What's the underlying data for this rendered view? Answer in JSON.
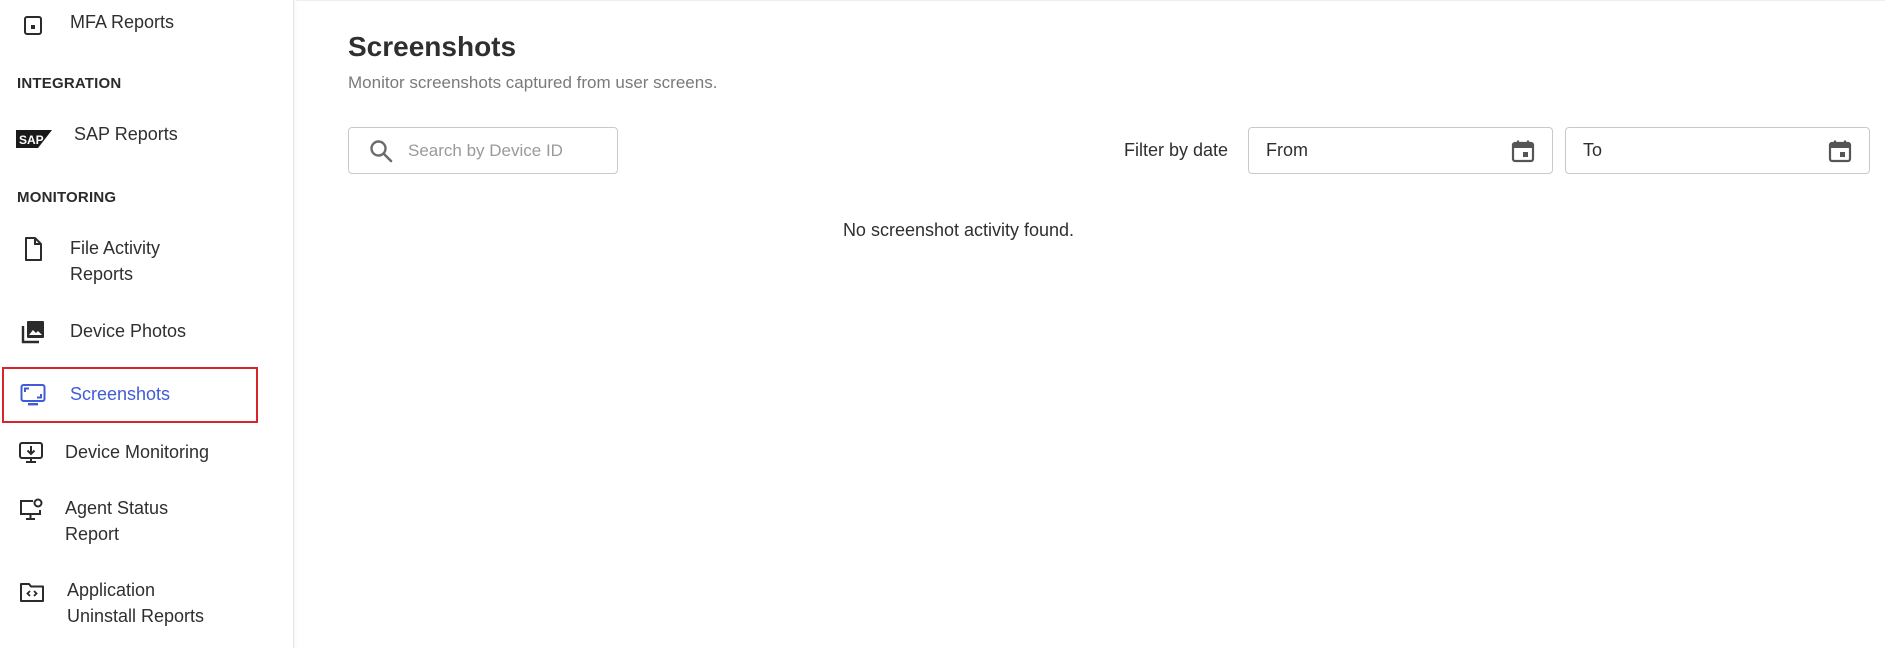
{
  "sidebar": {
    "partial_item": {
      "label": "MFA Reports",
      "icon": "calendar-dot-icon"
    },
    "sections": [
      {
        "title": "INTEGRATION"
      },
      {
        "title": "MONITORING"
      }
    ],
    "sap": {
      "logo_text": "SAP",
      "label": "SAP Reports"
    },
    "items": [
      {
        "label_line1": "File Activity",
        "label_line2": "Reports",
        "icon": "file-icon"
      },
      {
        "label_line1": "Device Photos",
        "icon": "photo-library-icon"
      },
      {
        "label_line1": "Screenshots",
        "icon": "screenshot-monitor-icon"
      },
      {
        "label_line1": "Device Monitoring",
        "icon": "monitor-download-icon"
      },
      {
        "label_line1": "Agent Status",
        "label_line2": "Report",
        "icon": "monitor-person-icon"
      },
      {
        "label_line1": "Application",
        "label_line2": "Uninstall Reports",
        "icon": "folder-code-icon"
      }
    ],
    "active_color": "#3f5bd6",
    "highlight_color": "#d7262b"
  },
  "main": {
    "title": "Screenshots",
    "subtitle": "Monitor screenshots captured from user screens.",
    "search": {
      "placeholder": "Search by Device ID",
      "value": ""
    },
    "filter_label": "Filter by date",
    "from_label": "From",
    "to_label": "To",
    "empty_message": "No screenshot activity found."
  }
}
